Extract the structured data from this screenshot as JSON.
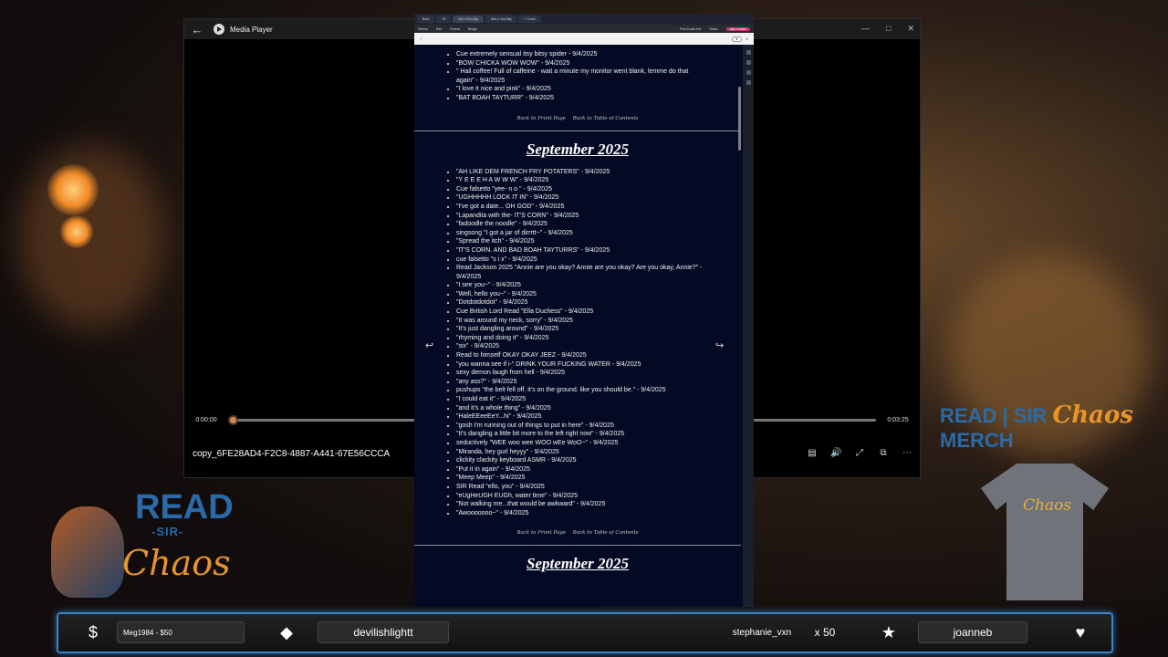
{
  "media_player": {
    "title": "Media Player",
    "time_current": "0:00:00",
    "time_total": "0:03:25",
    "progress": 0.0,
    "filename": "copy_6FE28AD4-F2C8-4887-A441-67E56CCCA"
  },
  "browser": {
    "tabs": [
      "Brea",
      "Ta",
      "Ask a Sco-Blg",
      "Add a Sco-Blg",
      "+ Cover"
    ],
    "menus": [
      "History",
      "Edit",
      "Format",
      "Bridge",
      "Find books link",
      "Share",
      "Ask a writer"
    ],
    "top_quotes": [
      "Cue extremely sensual itsy bitsy spider - 9/4/2025",
      "\"BOW CHICKA WOW WOW\" - 9/4/2025",
      "\" Hail coffee! Full of caffeine - wait a minute my monitor went blank, lemme do that again\" - 9/4/2025",
      "\"I love it nice and pink\" - 9/4/2025",
      "\"BAT BOAH TAYTURR\" - 9/4/2025"
    ],
    "nav_front": "Back to Front Page",
    "nav_toc": "Back to Table of Contents",
    "month_heading": "September 2025",
    "quotes": [
      "\"AH LIKE DEM FRENCH FRY POTATERS\" - 9/4/2025",
      "\"Y E E E H A W W W\" - 9/4/2025",
      "Cue falsetto \"yee- n o \" - 9/4/2025",
      "\"UGHHHHH LOCK IT IN\" - 9/4/2025",
      "\"I've got a date... OH GOD\" - 9/4/2025",
      "\"Lapandita with the- IT'S CORN\" - 9/4/2025",
      "\"fadoodle the noodle\" - 9/4/2025",
      "singsong \"I got a jar of dirrrtt~\" - 9/4/2025",
      "\"Spread the itch\" - 9/4/2025",
      "\"IT'S CORN. AND BAD BOAH TAYTURRS\" - 9/4/2025",
      "cue falsetto \"s i x\" - 9/4/2025",
      "Read Jackson 2025 \"Annie are you okay? Annie are you okay? Are you okay, Annie?\" - 9/4/2025",
      "\"I see you~\" - 9/4/2025",
      "\"Well, hello you~\" - 9/4/2025",
      "\"Dotdotdotdot\" - 9/4/2025",
      "Cue British Lord Read \"Ella Duchess\" - 9/4/2025",
      "\"It was around my neck, sorry\" - 9/4/2025",
      "\"It's just dangling around\" - 9/4/2025",
      "\"rhyming and doing it\" - 9/4/2025",
      "\"six\" - 9/4/2025",
      "Read to himself OKAY OKAY JEEZ - 9/4/2025",
      "\"you wanna see if i-\" DRINK YOUR FUCKING WATER - 9/4/2025",
      "sexy demon laugh from hell - 9/4/2025",
      "\"any ass?\" - 9/4/2025",
      "pushups \"the belt fell off. it's on the ground. like you should be.\" - 9/4/2025",
      "\"I could eat it\" - 9/4/2025",
      "\"and it's a whole thing\" - 9/4/2025",
      "\"HaleEEeeEeY...hi\" - 9/4/2025",
      "\"gosh I'm running out of things to put in here\" - 9/4/2025",
      "\"It's dangling a little bit more to the left right now\" - 9/4/2025",
      "seductively \"WEE woo wee WOO wEe WoO~\" - 9/4/2025",
      "\"Miranda, hey gurl heyyy\" - 9/4/2025",
      "clickity clackity keyboard ASMR - 9/4/2025",
      "\"Put it in again\" - 9/4/2025",
      "\"Meep Meep\" - 9/4/2025",
      "SIR Read \"ello, you\" - 9/4/2025",
      "\"eUgHeUGH EUGh, water time\" - 9/4/2025",
      "\"Not walking me...that would be awkward\" - 9/4/2025",
      "\"Awooooooo~\" - 9/4/2025"
    ]
  },
  "overlay": {
    "logo_read": "READ",
    "logo_sir": "-SIR-",
    "logo_chaos": "Chaos",
    "merch_prefix": "READ | SIR",
    "merch_chaos": "Chaos",
    "merch_suffix": "MERCH",
    "shirt_text": "Chaos",
    "bar": {
      "dollar_icon": "$",
      "donation": "Meg1984 - $50",
      "gem_icon": "◆",
      "sub_user": "devilishlightt",
      "gift_user": "stephanie_vxn",
      "gift_count": "x 50",
      "star_icon": "★",
      "follower": "joanneb",
      "heart_icon": "♥"
    }
  },
  "colors": {
    "accent_blue": "#3b82c6",
    "accent_orange": "#e8942c",
    "browser_bg": "#040a24"
  }
}
